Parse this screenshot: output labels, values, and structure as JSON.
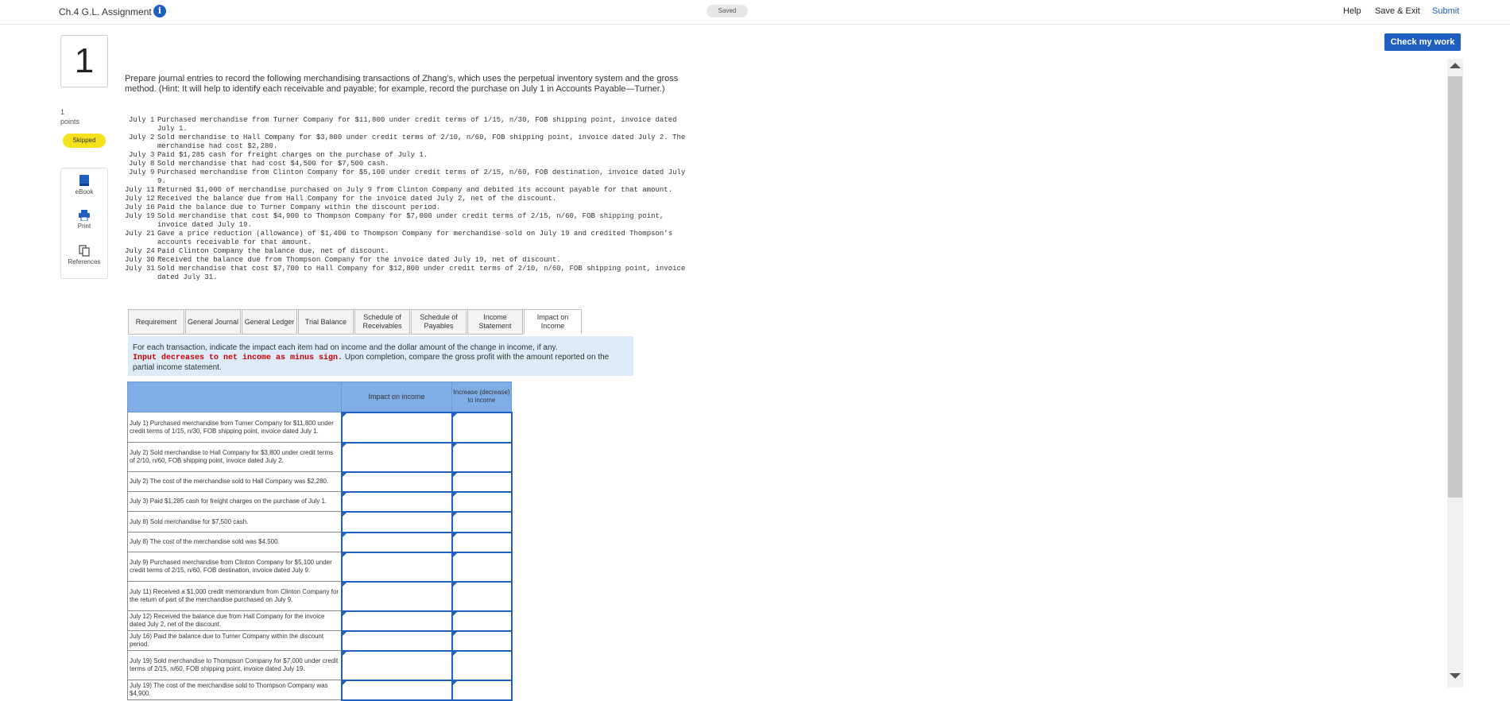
{
  "header": {
    "title": "Ch.4 G.L. Assignment",
    "info_icon": "info-icon",
    "saved_status": "Saved",
    "help": "Help",
    "save_exit": "Save & Exit",
    "submit": "Submit"
  },
  "check_button": "Check my work",
  "question": {
    "number": "1",
    "points_value": "1",
    "points_label": "points",
    "status": "Skipped",
    "prompt": "Prepare journal entries to record the following merchandising transactions of Zhang’s, which uses the perpetual inventory system and the gross method. (Hint: It will help to identify each receivable and payable; for example, record the purchase on July 1 in Accounts Payable—Turner.)",
    "transactions": [
      {
        "date": "July 1",
        "text": "Purchased merchandise from Turner Company for $11,800 under credit terms of 1/15, n/30, FOB shipping point, invoice dated July 1."
      },
      {
        "date": "July 2",
        "text": "Sold merchandise to Hall Company for $3,800 under credit terms of 2/10, n/60, FOB shipping point, invoice dated July 2. The merchandise had cost $2,280."
      },
      {
        "date": "July 3",
        "text": "Paid $1,285 cash for freight charges on the purchase of July 1."
      },
      {
        "date": "July 8",
        "text": "Sold merchandise that had cost $4,500 for $7,500 cash."
      },
      {
        "date": "July 9",
        "text": "Purchased merchandise from Clinton Company for $5,100 under credit terms of 2/15, n/60, FOB destination, invoice dated July 9."
      },
      {
        "date": "July 11",
        "text": "Returned $1,000 of merchandise purchased on July 9 from Clinton Company and debited its account payable for that amount."
      },
      {
        "date": "July 12",
        "text": "Received the balance due from Hall Company for the invoice dated July 2, net of the discount."
      },
      {
        "date": "July 16",
        "text": "Paid the balance due to Turner Company within the discount period."
      },
      {
        "date": "July 19",
        "text": "Sold merchandise that cost $4,900 to Thompson Company for $7,000 under credit terms of 2/15, n/60, FOB shipping point, invoice dated July 19."
      },
      {
        "date": "July 21",
        "text": "Gave a price reduction (allowance) of $1,400 to Thompson Company for merchandise sold on July 19 and credited Thompson’s accounts receivable for that amount."
      },
      {
        "date": "July 24",
        "text": "Paid Clinton Company the balance due, net of discount."
      },
      {
        "date": "July 30",
        "text": "Received the balance due from Thompson Company for the invoice dated July 19, net of discount."
      },
      {
        "date": "July 31",
        "text": "Sold merchandise that cost $7,700 to Hall Company for $12,800 under credit terms of 2/10, n/60, FOB shipping point, invoice dated July 31."
      }
    ]
  },
  "tools": [
    {
      "label": "eBook",
      "icon": "book-icon"
    },
    {
      "label": "Print",
      "icon": "printer-icon"
    },
    {
      "label": "References",
      "icon": "copy-icon"
    }
  ],
  "tabs": [
    {
      "label": "Requirement",
      "active": false
    },
    {
      "label": "General Journal",
      "active": false
    },
    {
      "label": "General Ledger",
      "active": false
    },
    {
      "label": "Trial Balance",
      "active": false
    },
    {
      "label": "Schedule of Receivables",
      "active": false
    },
    {
      "label": "Schedule of Payables",
      "active": false
    },
    {
      "label": "Income Statement",
      "active": false
    },
    {
      "label": "Impact on Income",
      "active": true
    }
  ],
  "instructions": {
    "part1": "For each transaction, indicate the impact each item had on income and the dollar amount of the change in income, if any.",
    "part2_red": "Input decreases to net income as minus sign.",
    "part3": " Upon completion, compare the gross profit with the amount reported on the partial income statement."
  },
  "table": {
    "col_blank": "",
    "col_impact": "Impact on income",
    "col_change": "Increase (decrease) to income",
    "rows": [
      {
        "label": "July 1) Purchased merchandise from Turner Company for $11,800 under credit terms of 1/15, n/30, FOB shipping point, invoice dated July 1.",
        "impact": "",
        "change": ""
      },
      {
        "label": "July 2) Sold merchandise to Hall Company for $3,800 under credit terms of 2/10, n/60, FOB shipping point, invoice dated July 2.",
        "impact": "",
        "change": ""
      },
      {
        "label": "July 2) The cost of the merchandise sold to Hall Company was $2,280.",
        "impact": "",
        "change": ""
      },
      {
        "label": "July 3) Paid $1,285 cash for freight charges on the purchase of July 1.",
        "impact": "",
        "change": ""
      },
      {
        "label": "July 8) Sold merchandise for $7,500 cash.",
        "impact": "",
        "change": ""
      },
      {
        "label": "July 8) The cost of the merchandise sold was $4,500.",
        "impact": "",
        "change": ""
      },
      {
        "label": "July 9) Purchased merchandise from Clinton Company for $5,100 under credit terms of 2/15, n/60, FOB destination, invoice dated July 9.",
        "impact": "",
        "change": ""
      },
      {
        "label": "July 11) Received a $1,000 credit memorandum from Clinton Company for the return of part of the merchandise purchased on July 9.",
        "impact": "",
        "change": ""
      },
      {
        "label": "July 12) Received the balance due from Hall Company for the invoice dated July 2, net of the discount.",
        "impact": "",
        "change": ""
      },
      {
        "label": "July 16) Paid the balance due to Turner Company within the discount period.",
        "impact": "",
        "change": ""
      },
      {
        "label": "July 19) Sold merchandise to Thompson Company for $7,000 under credit terms of 2/15, n/60, FOB shipping point, invoice dated July 19.",
        "impact": "",
        "change": ""
      },
      {
        "label": "July 19) The cost of the merchandise sold to Thompson Company was $4,900.",
        "impact": "",
        "change": ""
      }
    ]
  },
  "colors": {
    "accent": "#1e5fbf",
    "header_fill": "#7faee6",
    "instructions_bg": "#dcebf7",
    "skipped": "#f5e11c",
    "red_text": "#cc0000"
  }
}
